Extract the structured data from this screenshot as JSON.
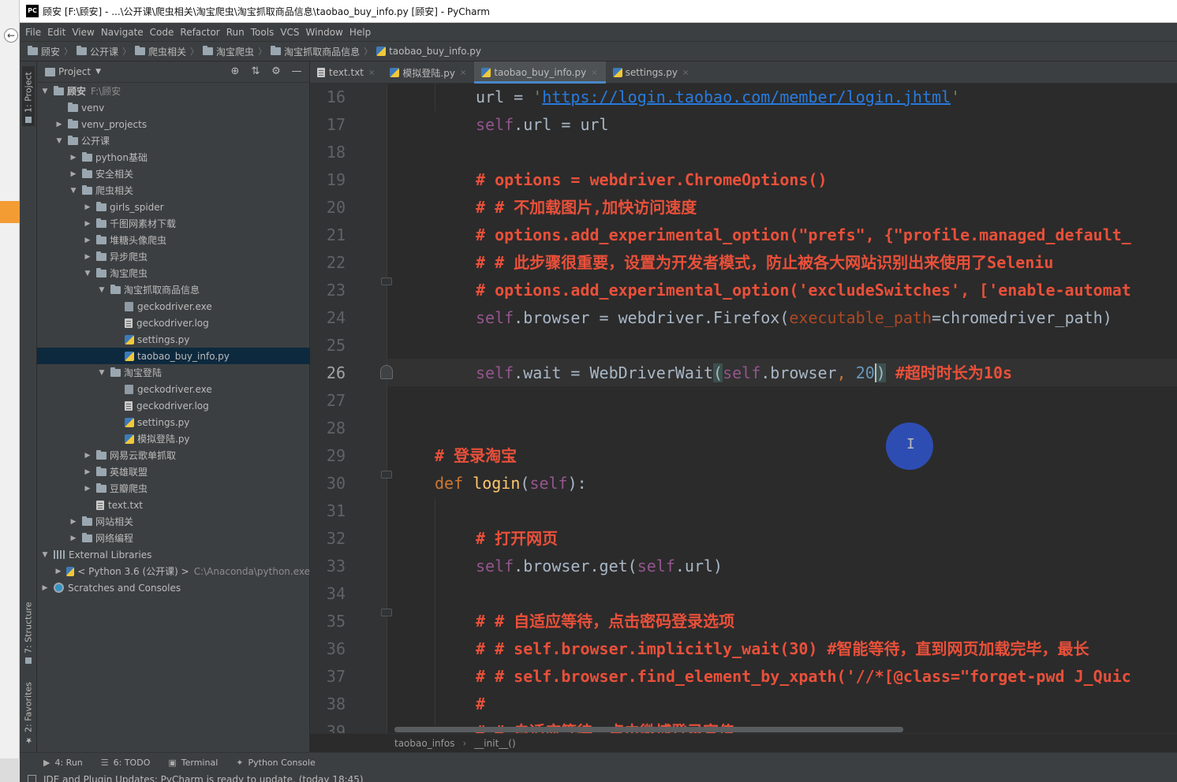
{
  "window": {
    "logo": "PC",
    "title": "顾安 [F:\\顾安] - ...\\公开课\\爬虫相关\\淘宝爬虫\\淘宝抓取商品信息\\taobao_buy_info.py [顾安] - PyCharm"
  },
  "menu": [
    "File",
    "Edit",
    "View",
    "Navigate",
    "Code",
    "Refactor",
    "Run",
    "Tools",
    "VCS",
    "Window",
    "Help"
  ],
  "breadcrumb": [
    "顾安",
    "公开课",
    "爬虫相关",
    "淘宝爬虫",
    "淘宝抓取商品信息",
    "taobao_buy_info.py"
  ],
  "tool_stripe": {
    "project": "1: Project",
    "structure": "7: Structure",
    "favorites": "2: Favorites"
  },
  "project_panel": {
    "title": "Project",
    "tree": [
      {
        "label": "顾安",
        "extra": "F:\\顾安",
        "depth": 0,
        "arrow": "open",
        "icon": "project"
      },
      {
        "label": "venv",
        "depth": 1,
        "arrow": "none",
        "icon": "folder"
      },
      {
        "label": "venv_projects",
        "depth": 1,
        "arrow": "closed",
        "icon": "folder"
      },
      {
        "label": "公开课",
        "depth": 1,
        "arrow": "open",
        "icon": "folder"
      },
      {
        "label": "python基础",
        "depth": 2,
        "arrow": "closed",
        "icon": "folder"
      },
      {
        "label": "安全相关",
        "depth": 2,
        "arrow": "closed",
        "icon": "folder"
      },
      {
        "label": "爬虫相关",
        "depth": 2,
        "arrow": "open",
        "icon": "folder"
      },
      {
        "label": "girls_spider",
        "depth": 3,
        "arrow": "closed",
        "icon": "folder"
      },
      {
        "label": "千图网素材下载",
        "depth": 3,
        "arrow": "closed",
        "icon": "folder"
      },
      {
        "label": "堆糖头像爬虫",
        "depth": 3,
        "arrow": "closed",
        "icon": "folder"
      },
      {
        "label": "异步爬虫",
        "depth": 3,
        "arrow": "closed",
        "icon": "folder"
      },
      {
        "label": "淘宝爬虫",
        "depth": 3,
        "arrow": "open",
        "icon": "folder"
      },
      {
        "label": "淘宝抓取商品信息",
        "depth": 4,
        "arrow": "open",
        "icon": "folder"
      },
      {
        "label": "geckodriver.exe",
        "depth": 5,
        "arrow": "none",
        "icon": "exe"
      },
      {
        "label": "geckodriver.log",
        "depth": 5,
        "arrow": "none",
        "icon": "file"
      },
      {
        "label": "settings.py",
        "depth": 5,
        "arrow": "none",
        "icon": "py"
      },
      {
        "label": "taobao_buy_info.py",
        "depth": 5,
        "arrow": "none",
        "icon": "py",
        "selected": true
      },
      {
        "label": "淘宝登陆",
        "depth": 4,
        "arrow": "open",
        "icon": "folder"
      },
      {
        "label": "geckodriver.exe",
        "depth": 5,
        "arrow": "none",
        "icon": "exe"
      },
      {
        "label": "geckodriver.log",
        "depth": 5,
        "arrow": "none",
        "icon": "file"
      },
      {
        "label": "settings.py",
        "depth": 5,
        "arrow": "none",
        "icon": "py"
      },
      {
        "label": "模拟登陆.py",
        "depth": 5,
        "arrow": "none",
        "icon": "py"
      },
      {
        "label": "网易云歌单抓取",
        "depth": 3,
        "arrow": "closed",
        "icon": "folder"
      },
      {
        "label": "英雄联盟",
        "depth": 3,
        "arrow": "closed",
        "icon": "folder"
      },
      {
        "label": "豆瓣爬虫",
        "depth": 3,
        "arrow": "closed",
        "icon": "folder"
      },
      {
        "label": "text.txt",
        "depth": 3,
        "arrow": "none",
        "icon": "file"
      },
      {
        "label": "网站相关",
        "depth": 2,
        "arrow": "closed",
        "icon": "folder"
      },
      {
        "label": "网络编程",
        "depth": 2,
        "arrow": "closed",
        "icon": "folder"
      },
      {
        "label": "External Libraries",
        "depth": 0,
        "arrow": "open",
        "icon": "lib"
      },
      {
        "label": "< Python 3.6 (公开课) >",
        "extra": "C:\\Anaconda\\python.exe",
        "depth": 1,
        "arrow": "closed",
        "icon": "py"
      },
      {
        "label": "Scratches and Consoles",
        "depth": 0,
        "arrow": "closed",
        "icon": "scratch"
      }
    ]
  },
  "tabs": [
    {
      "label": "text.txt",
      "icon": "file",
      "active": false
    },
    {
      "label": "模拟登陆.py",
      "icon": "py",
      "active": false
    },
    {
      "label": "taobao_buy_info.py",
      "icon": "py",
      "active": true
    },
    {
      "label": "settings.py",
      "icon": "py",
      "active": false
    }
  ],
  "editor": {
    "first_line": 16,
    "current_line": 26,
    "line_count": 24
  },
  "code_lines": {
    "l16_url": "url",
    "l16_eq": " = ",
    "l16_q1": "'",
    "l16_link": "https://login.taobao.com/member/login.jhtml",
    "l16_q2": "'",
    "l17_self": "self",
    "l17_rest": ".url = url",
    "l19": "# options = webdriver.ChromeOptions()",
    "l20": "# # 不加载图片,加快访问速度",
    "l21": "# options.add_experimental_option(\"prefs\", {\"profile.managed_default_",
    "l22": "# # 此步骤很重要，设置为开发者模式，防止被各大网站识别出来使用了Seleniu",
    "l23": "# options.add_experimental_option('excludeSwitches', ['enable-automat",
    "l24_self": "self",
    "l24_a": ".browser = webdriver.Firefox(",
    "l24_param": "executable_path",
    "l24_b": "=chromedriver_path)",
    "l26_self": "self",
    "l26_a": ".wait = WebDriverWait",
    "l26_paren": "(",
    "l26_self2": "self",
    "l26_b": ".browser",
    "l26_comma": ", ",
    "l26_num_a": "2",
    "l26_num_b": "0",
    "l26_close": ")",
    "l26_comment": " #超时时长为10s",
    "l29": "# 登录淘宝",
    "l30_def": "def ",
    "l30_fn": "login",
    "l30_open": "(",
    "l30_self": "self",
    "l30_close": "):",
    "l32": "# 打开网页",
    "l33_self": "self",
    "l33_a": ".browser.get(",
    "l33_self2": "self",
    "l33_b": ".url)",
    "l35": "# # 自适应等待，点击密码登录选项",
    "l36": "# # self.browser.implicitly_wait(30) #智能等待，直到网页加载完毕，最长",
    "l37": "# # self.browser.find_element_by_xpath('//*[@class=\"forget-pwd J_Quic",
    "l38": "#",
    "l39": "# # 自适应等待，点击微博登录宣传"
  },
  "editor_breadcrumb": [
    "taobao_infos",
    "__init__()"
  ],
  "cursor_glyph": "I",
  "bottom_tools": [
    {
      "label": "4: Run",
      "icon": "▶"
    },
    {
      "label": "6: TODO",
      "icon": "☰"
    },
    {
      "label": "Terminal",
      "icon": "▣"
    },
    {
      "label": "Python Console",
      "icon": "✦"
    }
  ],
  "status": "IDE and Plugin Updates: PyCharm is ready to update. (today 18:45)"
}
